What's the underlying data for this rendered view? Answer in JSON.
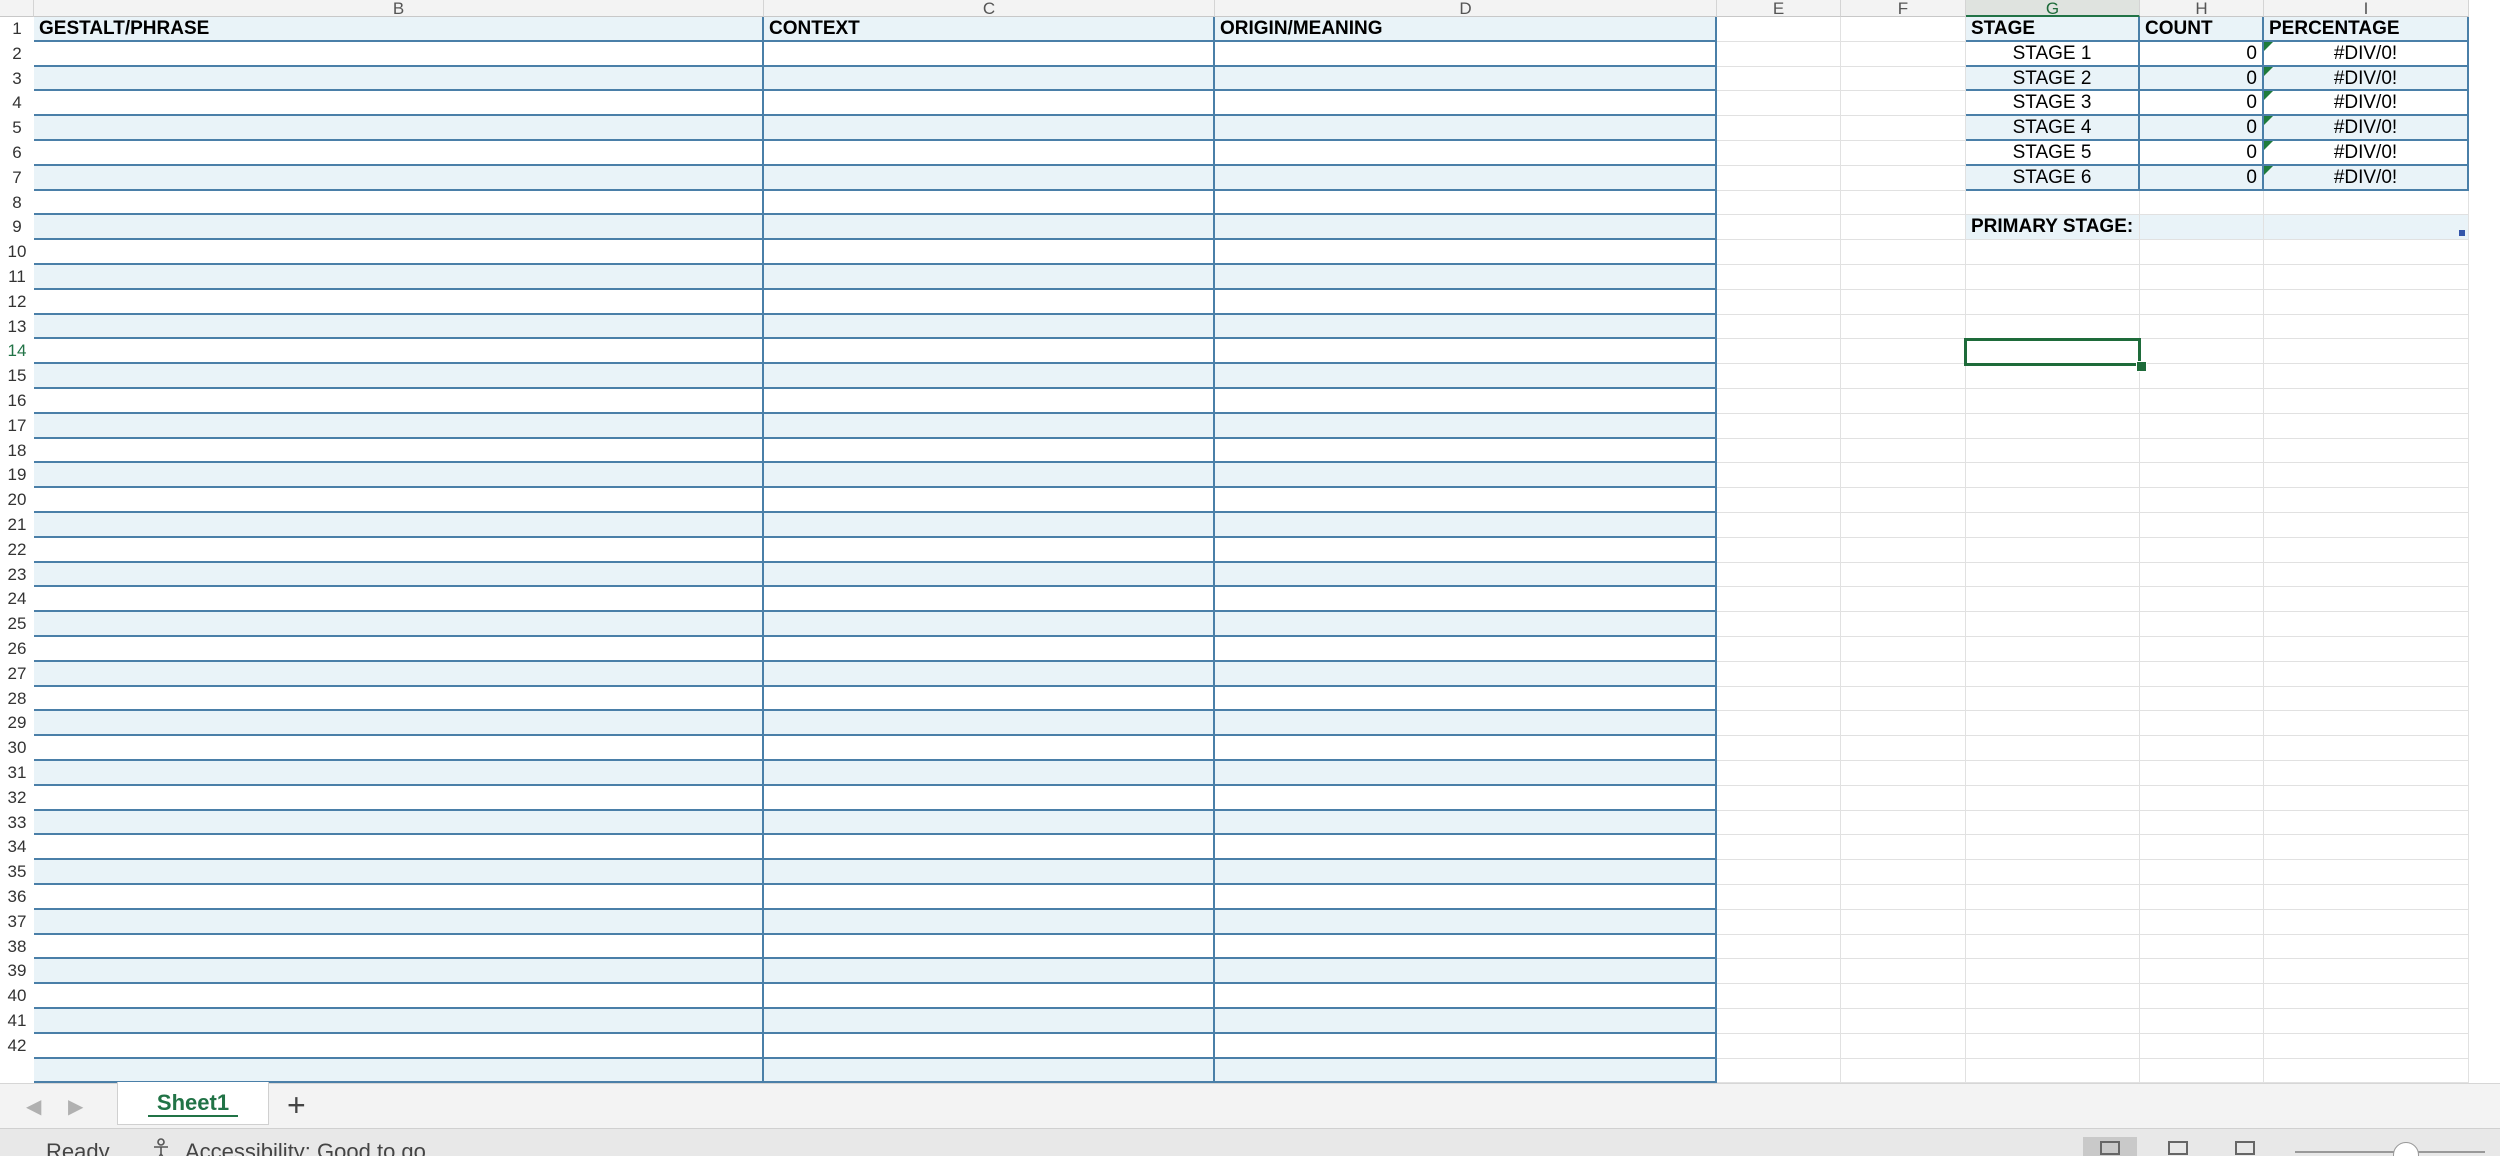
{
  "columns": [
    {
      "letter": "B",
      "selected": false
    },
    {
      "letter": "C",
      "selected": false
    },
    {
      "letter": "D",
      "selected": false
    },
    {
      "letter": "E",
      "selected": false
    },
    {
      "letter": "F",
      "selected": false
    },
    {
      "letter": "G",
      "selected": true
    },
    {
      "letter": "H",
      "selected": false
    },
    {
      "letter": "I",
      "selected": false
    }
  ],
  "active_row": 14,
  "main_table": {
    "headers": [
      "GESTALT/PHRASE",
      "CONTEXT",
      "ORIGIN/MEANING"
    ]
  },
  "stage_table": {
    "headers": [
      "STAGE",
      "COUNT",
      "PERCENTAGE"
    ],
    "rows": [
      {
        "stage": "STAGE 1",
        "count": "0",
        "percentage": "#DIV/0!"
      },
      {
        "stage": "STAGE 2",
        "count": "0",
        "percentage": "#DIV/0!"
      },
      {
        "stage": "STAGE 3",
        "count": "0",
        "percentage": "#DIV/0!"
      },
      {
        "stage": "STAGE 4",
        "count": "0",
        "percentage": "#DIV/0!"
      },
      {
        "stage": "STAGE 5",
        "count": "0",
        "percentage": "#DIV/0!"
      },
      {
        "stage": "STAGE 6",
        "count": "0",
        "percentage": "#DIV/0!"
      }
    ]
  },
  "primary_stage": {
    "label": "PRIMARY STAGE:"
  },
  "sheet_tabs": {
    "active": "Sheet1",
    "add_icon": "+",
    "prev_icon": "◀",
    "next_icon": "▶"
  },
  "status": {
    "ready": "Ready",
    "accessibility": "Accessibility: Good to go",
    "accessibility_icon": "accessibility-person-icon"
  },
  "colors": {
    "accent": "#217346",
    "table_border": "#4a7fa8",
    "band": "#e9f3f8"
  }
}
